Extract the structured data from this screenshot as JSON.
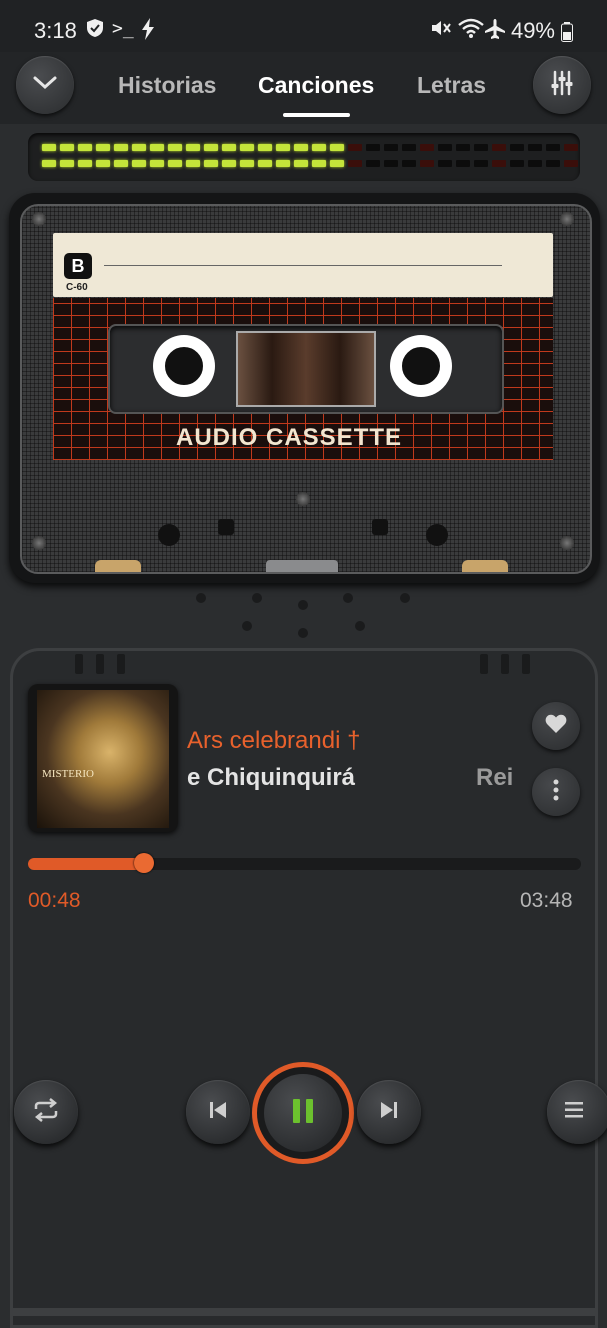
{
  "status_bar": {
    "time": "3:18",
    "battery": "49%",
    "icons": [
      "shield-check-icon",
      "terminal-icon",
      "bolt-icon",
      "mute-icon",
      "wifi-icon",
      "airplane-icon",
      "battery-icon"
    ]
  },
  "nav": {
    "tabs": [
      {
        "label": "Historias",
        "active": false
      },
      {
        "label": "Canciones",
        "active": true
      },
      {
        "label": "Letras",
        "active": false
      }
    ],
    "left_icon": "chevron-down-icon",
    "right_icon": "equalizer-icon"
  },
  "vu_meter": {
    "active_segments": 17,
    "total_segments": 30,
    "level": 0.57
  },
  "cassette": {
    "side": "B",
    "type": "C-60",
    "title": "AUDIO CASSETTE"
  },
  "player": {
    "title": "Ars celebrandi †",
    "artist": "e Chiquinquirá",
    "artist_next": "Rei",
    "current_time": "00:48",
    "duration": "03:48",
    "progress": 0.21
  },
  "art_text": "MISTERIO",
  "colors": {
    "accent": "#e05a28",
    "vu_on": "#c4e43a",
    "background": "#2b2d2f"
  }
}
